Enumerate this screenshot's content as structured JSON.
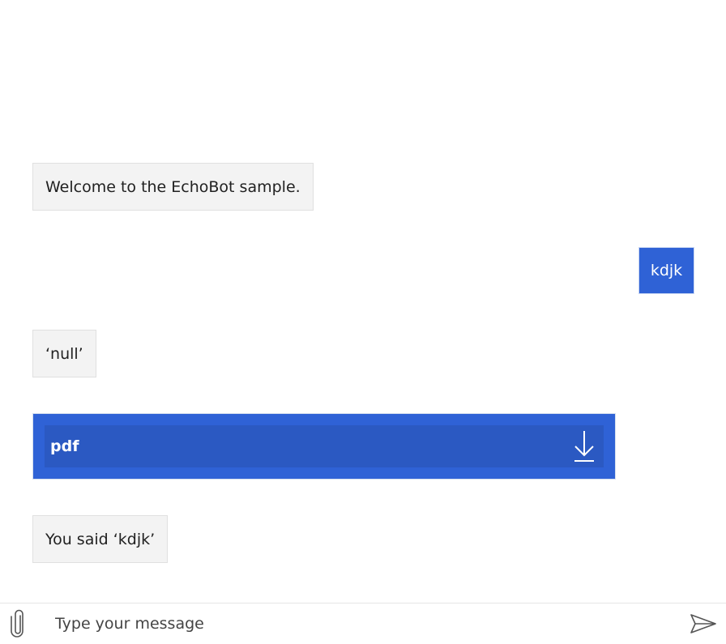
{
  "transcript": {
    "messages": [
      {
        "from": "bot",
        "text": "Welcome to the EchoBot sample."
      },
      {
        "from": "user",
        "text": "kdjk"
      },
      {
        "from": "bot",
        "text": "‘null’"
      },
      {
        "from": "bot",
        "attachment": {
          "name": "pdf",
          "icon": "download-icon"
        }
      },
      {
        "from": "bot",
        "text": "You said ‘kdjk’"
      }
    ]
  },
  "composer": {
    "placeholder": "Type your message",
    "attach_icon": "paperclip-icon",
    "send_icon": "send-icon"
  },
  "colors": {
    "user_bubble": "#2f62d6",
    "bot_bubble": "#f3f3f3",
    "attachment_inner": "#2b59c2"
  }
}
